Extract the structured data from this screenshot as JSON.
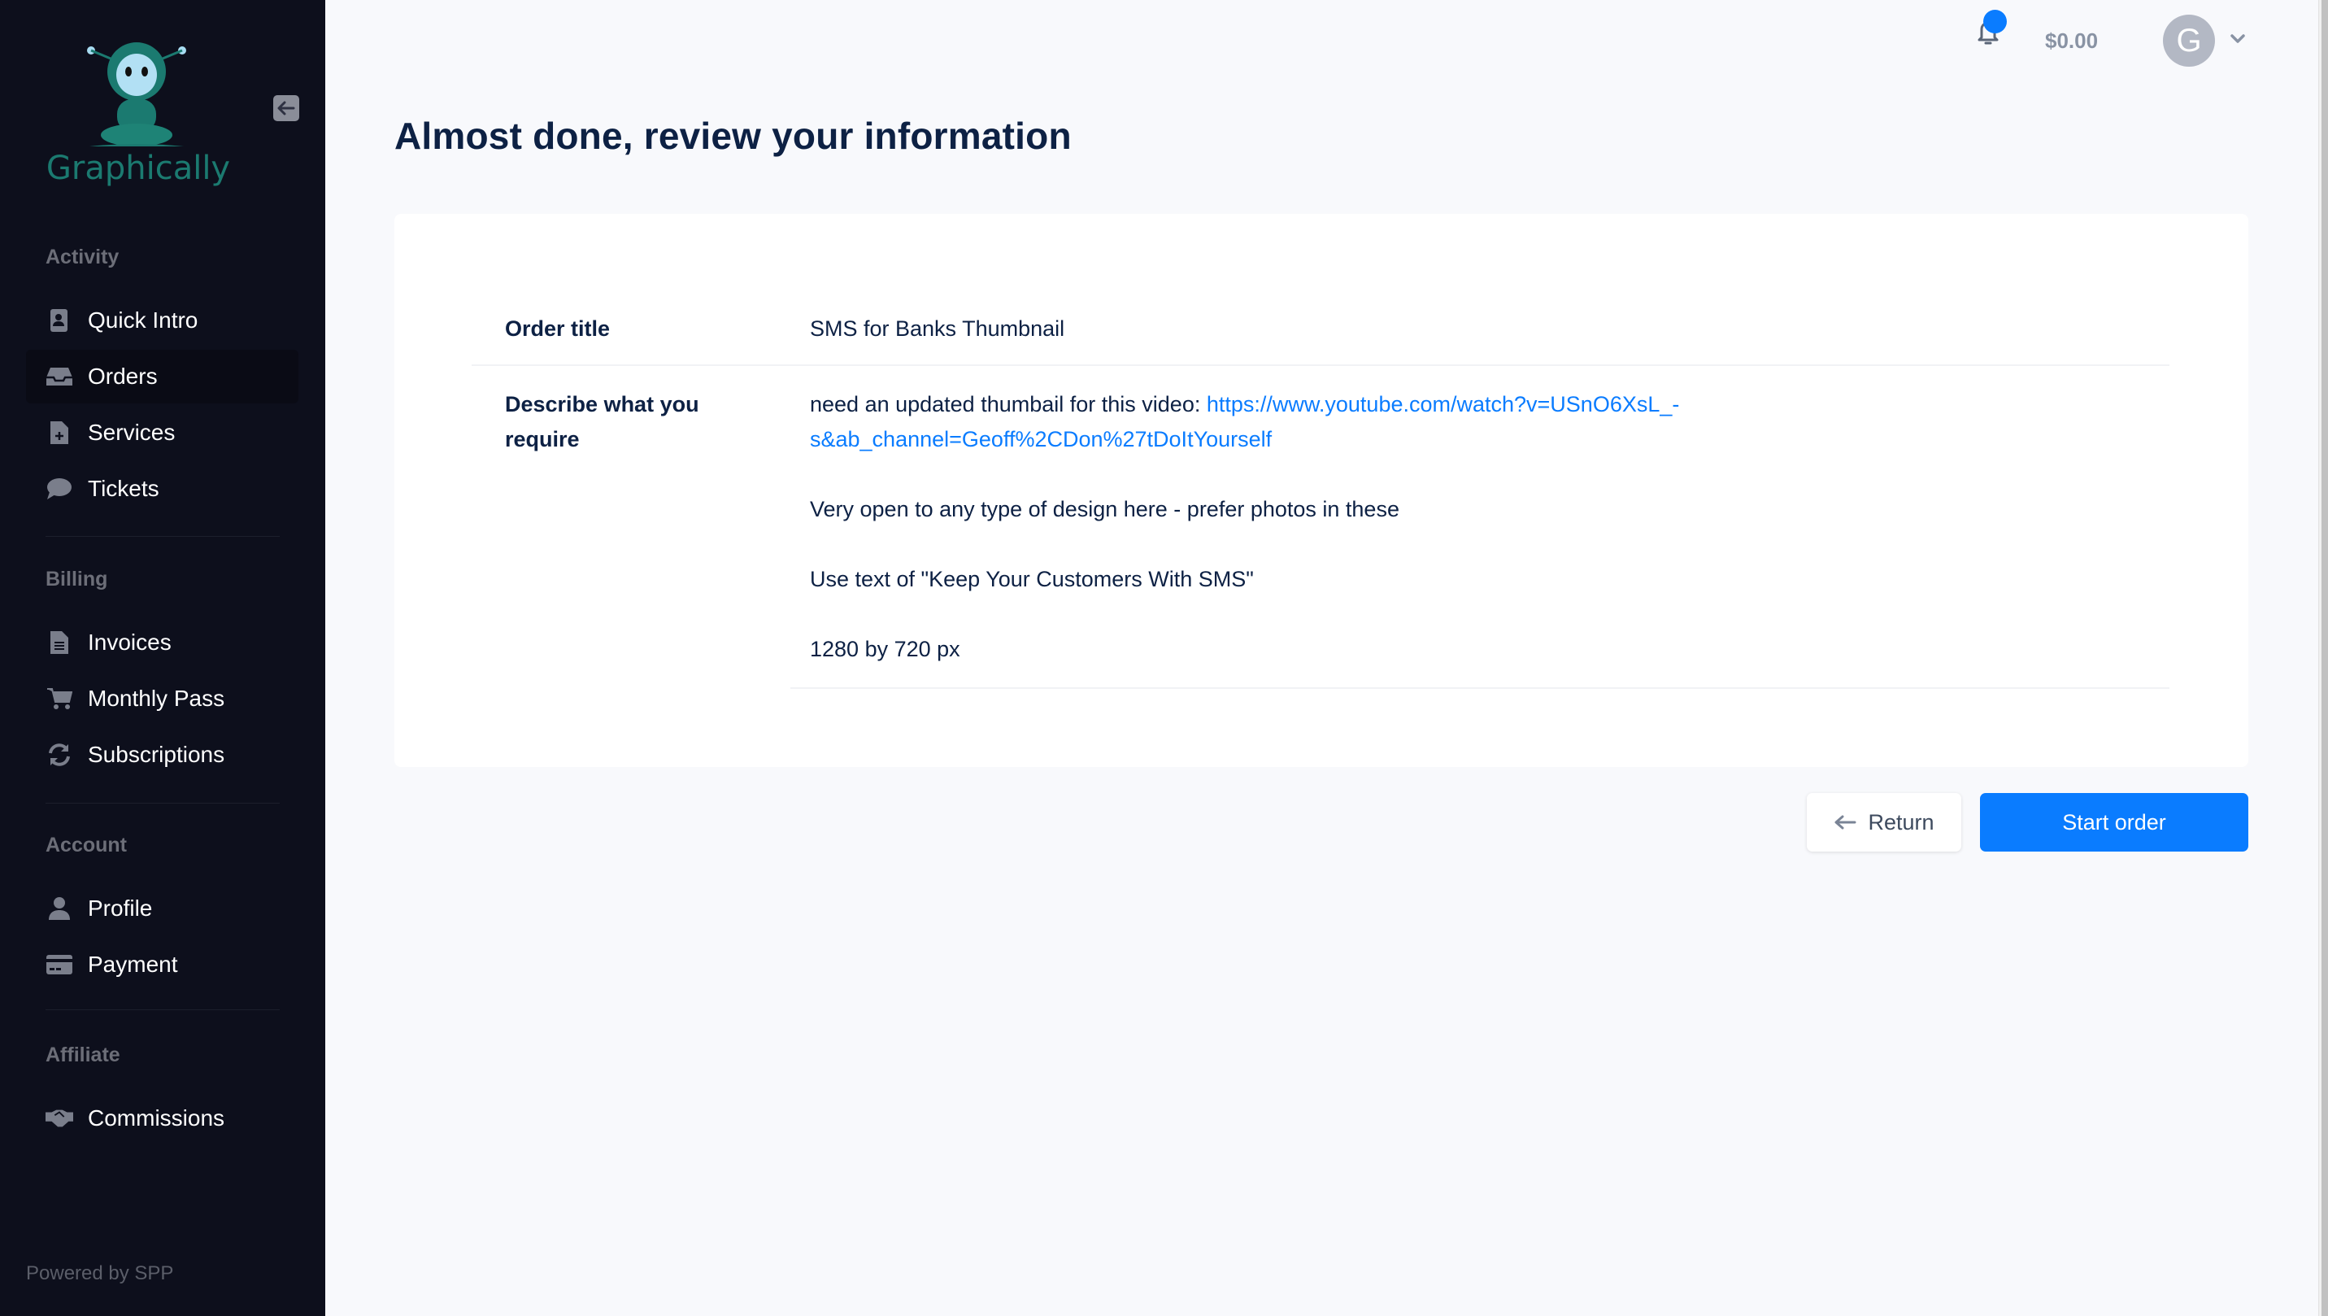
{
  "brand": {
    "name": "Graphically",
    "accent": "#0a7cff",
    "logo_color": "#1b7a70"
  },
  "sidebar": {
    "sections": [
      {
        "label": "Activity",
        "items": [
          {
            "label": "Quick Intro",
            "icon": "address-book-icon"
          },
          {
            "label": "Orders",
            "icon": "inbox-icon",
            "active": true
          },
          {
            "label": "Services",
            "icon": "file-plus-icon"
          },
          {
            "label": "Tickets",
            "icon": "chat-bubble-icon"
          }
        ]
      },
      {
        "label": "Billing",
        "items": [
          {
            "label": "Invoices",
            "icon": "file-text-icon"
          },
          {
            "label": "Monthly Pass",
            "icon": "shopping-cart-icon"
          },
          {
            "label": "Subscriptions",
            "icon": "refresh-icon"
          }
        ]
      },
      {
        "label": "Account",
        "items": [
          {
            "label": "Profile",
            "icon": "user-icon"
          },
          {
            "label": "Payment",
            "icon": "credit-card-icon"
          }
        ]
      },
      {
        "label": "Affiliate",
        "items": [
          {
            "label": "Commissions",
            "icon": "handshake-icon"
          }
        ]
      }
    ],
    "footer": "Powered by SPP"
  },
  "header": {
    "balance": "$0.00",
    "avatar_initial": "G"
  },
  "main": {
    "title": "Almost done, review your information",
    "rows": [
      {
        "label": "Order title",
        "value": "SMS for Banks Thumbnail"
      },
      {
        "label": "Describe what you require",
        "value_prefix": "need an updated thumbail for this video: ",
        "link_line1": "https://www.youtube.com/watch?v=USnO6XsL_-",
        "link_line2": "s&ab_channel=Geoff%2CDon%27tDoItYourself",
        "paragraphs": [
          "Very open to any type of design here - prefer photos in these",
          "Use text of \"Keep Your Customers With SMS\"",
          "1280 by 720 px"
        ]
      }
    ],
    "buttons": {
      "return": "Return",
      "start": "Start order"
    }
  }
}
